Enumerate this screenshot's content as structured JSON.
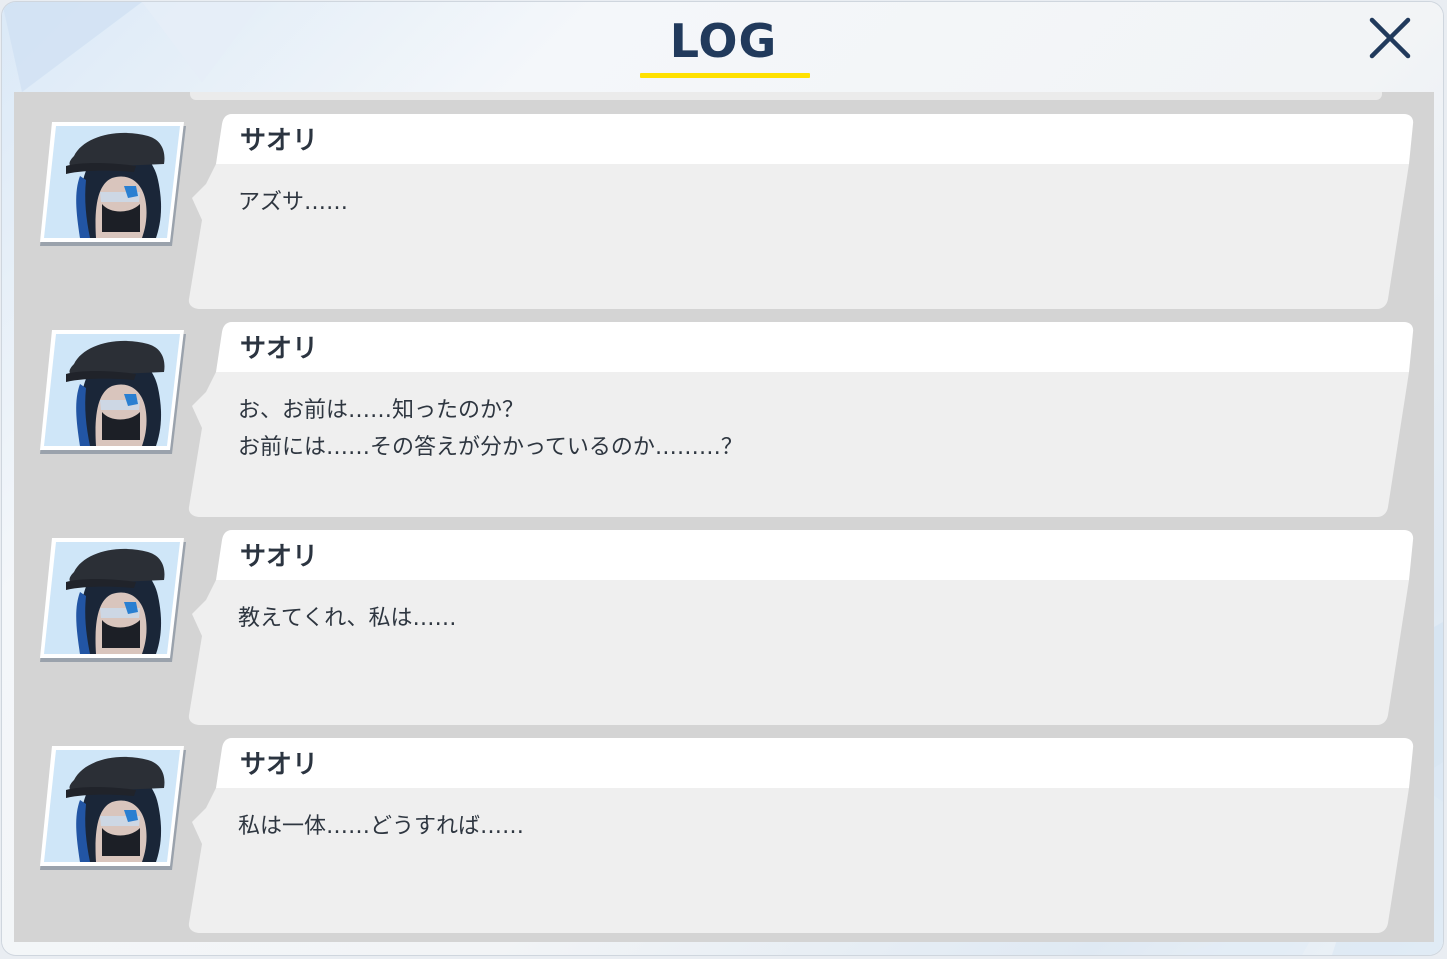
{
  "header": {
    "title": "LOG",
    "close_icon": "close-x-icon",
    "accent_color": "#ffe100",
    "title_color": "#213a5c"
  },
  "log": {
    "entries": [
      {
        "speaker": "サオリ",
        "avatar": "saori-portrait",
        "lines": [
          "アズサ……"
        ]
      },
      {
        "speaker": "サオリ",
        "avatar": "saori-portrait",
        "lines": [
          "お、お前は……知ったのか？",
          "お前には……その答えが分かっているのか………？"
        ]
      },
      {
        "speaker": "サオリ",
        "avatar": "saori-portrait",
        "lines": [
          "教えてくれ、私は……"
        ]
      },
      {
        "speaker": "サオリ",
        "avatar": "saori-portrait",
        "lines": [
          "私は一体……どうすれば……"
        ]
      }
    ]
  }
}
